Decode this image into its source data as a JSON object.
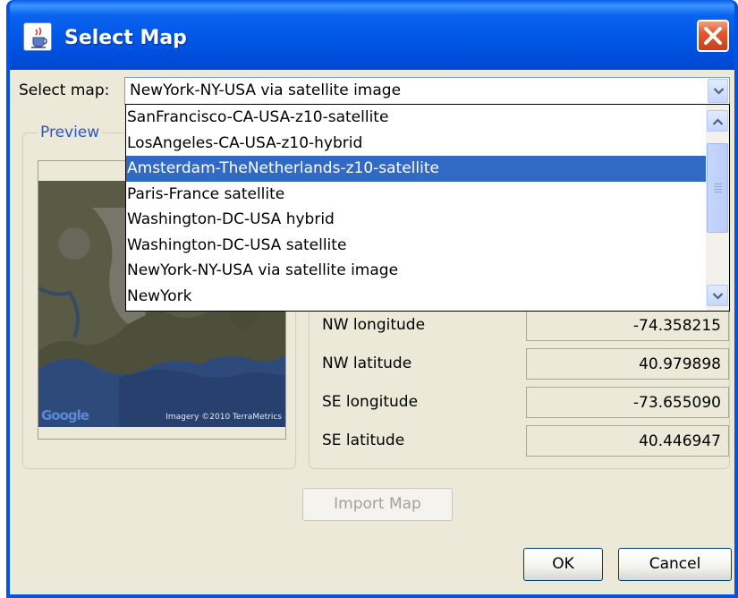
{
  "window": {
    "title": "Select Map",
    "title_icon": "java-cup-icon",
    "close_icon": "close-icon"
  },
  "select_map": {
    "label": "Select map:",
    "value": "NewYork-NY-USA via satellite image",
    "dropdown_icon": "chevron-down-icon"
  },
  "dropdown": {
    "items": [
      {
        "label": "SanFrancisco-CA-USA-z10-satellite",
        "selected": false
      },
      {
        "label": "LosAngeles-CA-USA-z10-hybrid",
        "selected": false
      },
      {
        "label": "Amsterdam-TheNetherlands-z10-satellite",
        "selected": true
      },
      {
        "label": "Paris-France satellite",
        "selected": false
      },
      {
        "label": "Washington-DC-USA hybrid",
        "selected": false
      },
      {
        "label": "Washington-DC-USA satellite",
        "selected": false
      },
      {
        "label": "NewYork-NY-USA via satellite image",
        "selected": false
      },
      {
        "label": "NewYork",
        "selected": false
      }
    ],
    "selection_color": "#316ac5"
  },
  "preview": {
    "legend": "Preview",
    "watermark": "Google",
    "copyright": "Imagery ©2010 TerraMetrics"
  },
  "coordinates": [
    {
      "label": "NW longitude",
      "value": "-74.358215"
    },
    {
      "label": "NW latitude",
      "value": "40.979898"
    },
    {
      "label": "SE longitude",
      "value": "-73.655090"
    },
    {
      "label": "SE latitude",
      "value": "40.446947"
    }
  ],
  "buttons": {
    "import": "Import Map",
    "ok": "OK",
    "cancel": "Cancel"
  },
  "colors": {
    "titlebar": "#0054e3",
    "dialog_background": "#ece9d8",
    "legend_text": "#2a57c8",
    "close_button": "#e2592f"
  }
}
